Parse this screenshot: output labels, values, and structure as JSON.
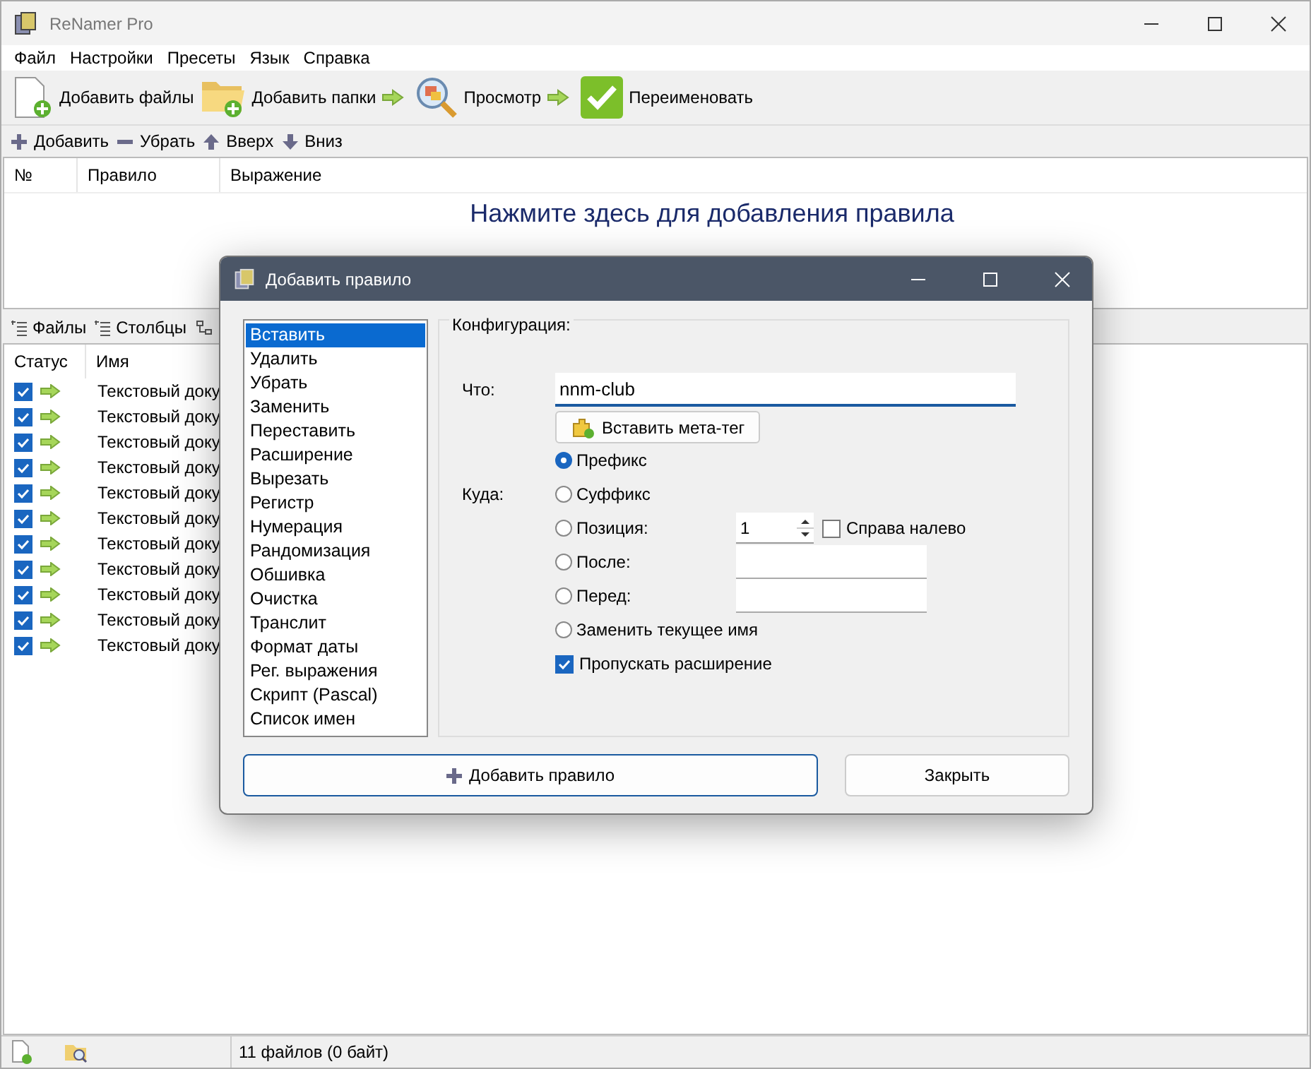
{
  "window": {
    "title": "ReNamer Pro"
  },
  "menu": [
    "Файл",
    "Настройки",
    "Пресеты",
    "Язык",
    "Справка"
  ],
  "toolbar": [
    {
      "kind": "add-files",
      "label": "Добавить файлы"
    },
    {
      "kind": "add-folders",
      "label": "Добавить папки"
    },
    {
      "kind": "preview",
      "label": "Просмотр"
    },
    {
      "kind": "rename",
      "label": "Переименовать"
    }
  ],
  "rule_toolbar": [
    {
      "kind": "add",
      "label": "Добавить"
    },
    {
      "kind": "remove",
      "label": "Убрать"
    },
    {
      "kind": "up",
      "label": "Вверх"
    },
    {
      "kind": "down",
      "label": "Вниз"
    }
  ],
  "rules_table": {
    "columns": [
      "№",
      "Правило",
      "Выражение"
    ],
    "hint": "Нажмите здесь для добавления правила"
  },
  "file_tabs": [
    {
      "label": "Файлы"
    },
    {
      "label": "Столбцы"
    }
  ],
  "files_table": {
    "columns": [
      "Статус",
      "Имя"
    ],
    "rows": [
      {
        "checked": true,
        "name": "Текстовый доку"
      },
      {
        "checked": true,
        "name": "Текстовый доку"
      },
      {
        "checked": true,
        "name": "Текстовый доку"
      },
      {
        "checked": true,
        "name": "Текстовый доку"
      },
      {
        "checked": true,
        "name": "Текстовый доку"
      },
      {
        "checked": true,
        "name": "Текстовый доку"
      },
      {
        "checked": true,
        "name": "Текстовый доку"
      },
      {
        "checked": true,
        "name": "Текстовый доку"
      },
      {
        "checked": true,
        "name": "Текстовый доку"
      },
      {
        "checked": true,
        "name": "Текстовый доку"
      },
      {
        "checked": true,
        "name": "Текстовый доку"
      }
    ]
  },
  "status_bar": {
    "text": "11 файлов (0 байт)"
  },
  "dialog": {
    "title": "Добавить правило",
    "rules": [
      {
        "label": "Вставить",
        "selected": true
      },
      {
        "label": "Удалить",
        "selected": false
      },
      {
        "label": "Убрать",
        "selected": false
      },
      {
        "label": "Заменить",
        "selected": false
      },
      {
        "label": "Переставить",
        "selected": false
      },
      {
        "label": "Расширение",
        "selected": false
      },
      {
        "label": "Вырезать",
        "selected": false
      },
      {
        "label": "Регистр",
        "selected": false
      },
      {
        "label": "Нумерация",
        "selected": false
      },
      {
        "label": "Рандомизация",
        "selected": false
      },
      {
        "label": "Обшивка",
        "selected": false
      },
      {
        "label": "Очистка",
        "selected": false
      },
      {
        "label": "Транслит",
        "selected": false
      },
      {
        "label": "Формат даты",
        "selected": false
      },
      {
        "label": "Рег. выражения",
        "selected": false
      },
      {
        "label": "Скрипт (Pascal)",
        "selected": false
      },
      {
        "label": "Список имен",
        "selected": false
      }
    ],
    "group_title": "Конфигурация:",
    "what_label": "Что:",
    "what_value": "nnm-club",
    "meta_button": "Вставить мета-тег",
    "where_label": "Куда:",
    "options": [
      {
        "kind": "plain",
        "label": "Префикс",
        "selected": true
      },
      {
        "kind": "plain",
        "label": "Суффикс",
        "selected": false
      },
      {
        "kind": "position",
        "label": "Позиция:",
        "selected": false
      },
      {
        "kind": "field",
        "label": "После:",
        "selected": false
      },
      {
        "kind": "field",
        "label": "Перед:",
        "selected": false
      },
      {
        "kind": "plain",
        "label": "Заменить текущее имя",
        "selected": false
      }
    ],
    "position_value": "1",
    "right_to_left": {
      "label": "Справа налево",
      "checked": false
    },
    "skip_extension": {
      "label": "Пропускать расширение",
      "checked": true
    },
    "buttons": [
      {
        "kind": "add",
        "label": "Добавить правило"
      },
      {
        "kind": "close",
        "label": "Закрыть"
      }
    ]
  }
}
